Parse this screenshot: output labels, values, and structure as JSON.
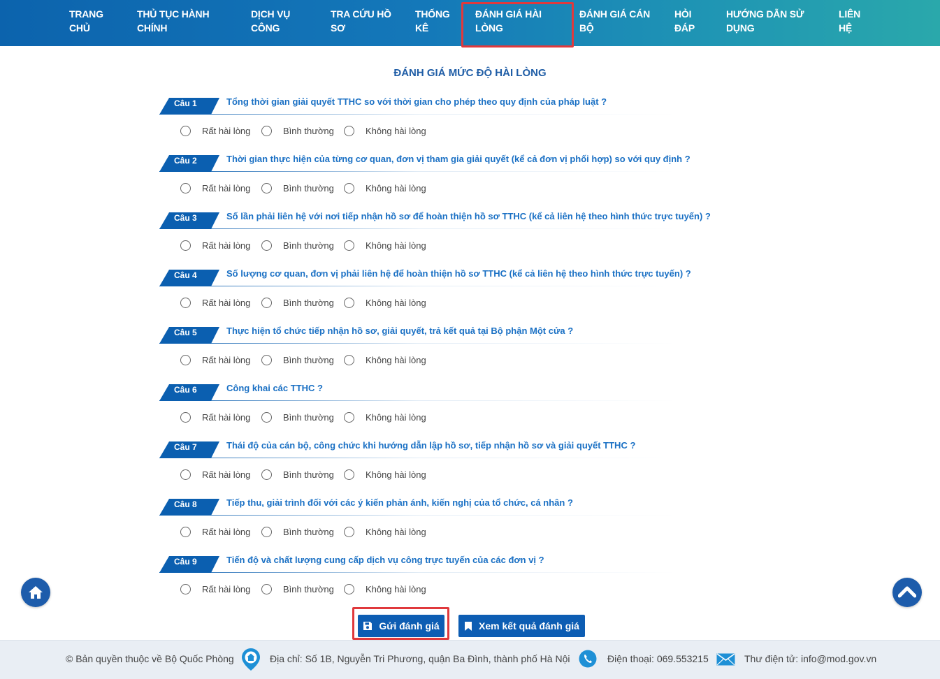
{
  "nav": {
    "items": [
      {
        "line1": "TRANG",
        "line2": "CHỦ"
      },
      {
        "line1": "THỦ TỤC HÀNH",
        "line2": "CHÍNH"
      },
      {
        "line1": "DỊCH VỤ",
        "line2": "CÔNG"
      },
      {
        "line1": "TRA CỨU HỒ",
        "line2": "SƠ"
      },
      {
        "line1": "THỐNG",
        "line2": "KÊ"
      },
      {
        "line1": "ĐÁNH GIÁ HÀI",
        "line2": "LÒNG"
      },
      {
        "line1": "ĐÁNH GIÁ CÁN",
        "line2": "BỘ"
      },
      {
        "line1": "HỎI",
        "line2": "ĐÁP"
      },
      {
        "line1": "HƯỚNG DẪN SỬ",
        "line2": "DỤNG"
      },
      {
        "line1": "LIÊN",
        "line2": "HỆ"
      }
    ],
    "active_index": 5
  },
  "page": {
    "title": "ĐÁNH GIÁ MỨC ĐỘ HÀI LÒNG"
  },
  "options": [
    "Rất hài lòng",
    "Bình thường",
    "Không hài lòng"
  ],
  "questions": [
    {
      "label": "Câu 1",
      "text": "Tổng thời gian giải quyết TTHC so với thời gian cho phép theo quy định của pháp luật ?"
    },
    {
      "label": "Câu 2",
      "text": "Thời gian thực hiện của từng cơ quan, đơn vị tham gia giải quyết (kể cả đơn vị phối hợp) so với quy định ?"
    },
    {
      "label": "Câu 3",
      "text": "Số lần phải liên hệ với nơi tiếp nhận hồ sơ để hoàn thiện hồ sơ TTHC (kể cả liên hệ theo hình thức trực tuyến) ?"
    },
    {
      "label": "Câu 4",
      "text": "Số lượng cơ quan, đơn vị phải liên hệ để hoàn thiện hồ sơ TTHC (kể cả liên hệ theo hình thức trực tuyến) ?"
    },
    {
      "label": "Câu 5",
      "text": "Thực hiện tổ chức tiếp nhận hồ sơ, giải quyết, trả kết quả tại Bộ phận Một cửa ?"
    },
    {
      "label": "Câu 6",
      "text": "Công khai các TTHC ?"
    },
    {
      "label": "Câu 7",
      "text": "Thái độ của cán bộ, công chức khi hướng dẫn lập hồ sơ, tiếp nhận hồ sơ và giải quyết TTHC ?"
    },
    {
      "label": "Câu 8",
      "text": "Tiếp thu, giải trình đối với các ý kiến phản ánh, kiến nghị của tổ chức, cá nhân ?"
    },
    {
      "label": "Câu 9",
      "text": "Tiến độ và chất lượng cung cấp dịch vụ công trực tuyến của các đơn vị ?"
    }
  ],
  "actions": {
    "submit": "Gửi đánh giá",
    "results": "Xem kết quả đánh giá"
  },
  "footer": {
    "copyright": "© Bản quyền thuộc về Bộ Quốc Phòng",
    "address": "Địa chỉ: Số 1B, Nguyễn Tri Phương, quận Ba Đình, thành phố Hà Nội",
    "phone": "Điện thoại: 069.553215",
    "email": "Thư điện tử: info@mod.gov.vn"
  },
  "icons": {
    "home_fab": "home-icon",
    "top_fab": "chevron-up-icon",
    "submit": "save-icon",
    "results": "bookmark-icon",
    "address": "location-pin-icon",
    "phone": "phone-icon",
    "email": "envelope-icon"
  },
  "colors": {
    "primary": "#0d5db3",
    "title": "#1f5da6",
    "question": "#1a70c4",
    "highlight": "#e0393c"
  }
}
